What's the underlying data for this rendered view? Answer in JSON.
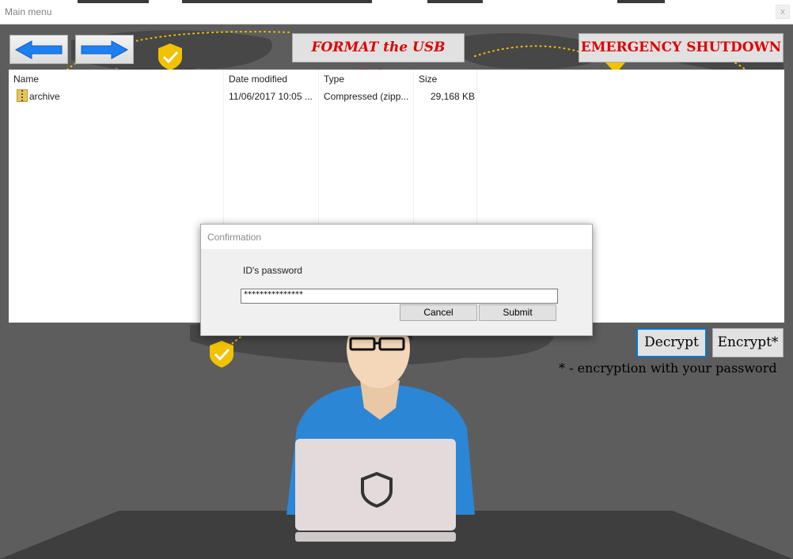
{
  "window": {
    "title": "Main menu",
    "close_glyph": "x"
  },
  "toolbar": {
    "back_icon": "arrow-left-icon",
    "forward_icon": "arrow-right-icon",
    "format_label": "FORMAT the USB Drive",
    "shutdown_label": "EMERGENCY SHUTDOWN",
    "accent_color": "#e00000"
  },
  "file_list": {
    "columns": [
      "Name",
      "Date modified",
      "Type",
      "Size"
    ],
    "rows": [
      {
        "icon": "zip-folder-icon",
        "name": "archive",
        "date": "11/06/2017 10:05 ...",
        "type": "Compressed (zipp...",
        "size": "29,168 KB"
      }
    ]
  },
  "dialog": {
    "title": "Confirmation",
    "prompt": "ID's password",
    "password_value": "***************",
    "cancel_label": "Cancel",
    "submit_label": "Submit"
  },
  "actions": {
    "decrypt_label": "Decrypt",
    "encrypt_label": "Encrypt*",
    "note": "* - encryption with your password"
  },
  "illustration": {
    "icons": [
      "shield-check-icon",
      "shield-icon",
      "world-map-icon",
      "person-with-laptop-icon"
    ]
  }
}
